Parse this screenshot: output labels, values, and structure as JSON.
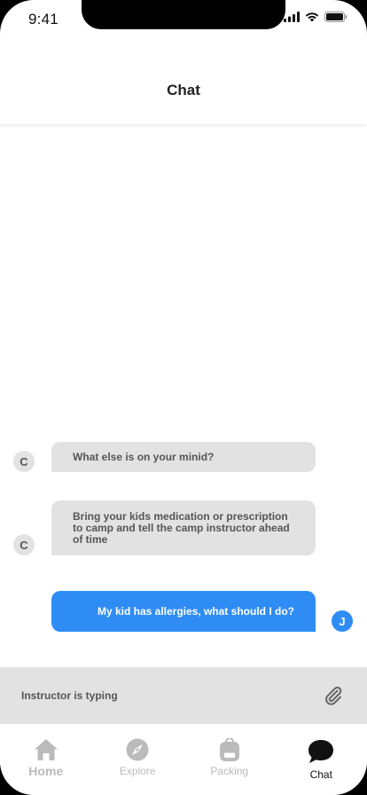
{
  "status_bar": {
    "time": "9:41"
  },
  "header": {
    "title": "Chat"
  },
  "messages": [
    {
      "sender": "other",
      "avatar": "C",
      "text": "What else is on your minid?"
    },
    {
      "sender": "other",
      "avatar": "C",
      "text": "Bring your kids medication or prescription to camp and tell the camp instructor ahead of time"
    },
    {
      "sender": "me",
      "avatar": "J",
      "text": "My kid has allergies, what should I do?"
    }
  ],
  "typing_bar": {
    "text": "Instructor is typing",
    "icon": "paperclip-icon"
  },
  "tabs": [
    {
      "label": "Home",
      "icon": "home-icon"
    },
    {
      "label": "Explore",
      "icon": "compass-icon"
    },
    {
      "label": "Packing",
      "icon": "backpack-icon"
    },
    {
      "label": "Chat",
      "icon": "chat-bubble-icon",
      "active": true
    }
  ],
  "colors": {
    "accent": "#2f8cf5",
    "bubble_gray": "#e2e2e2",
    "inactive_tab": "#bbbbbb"
  }
}
